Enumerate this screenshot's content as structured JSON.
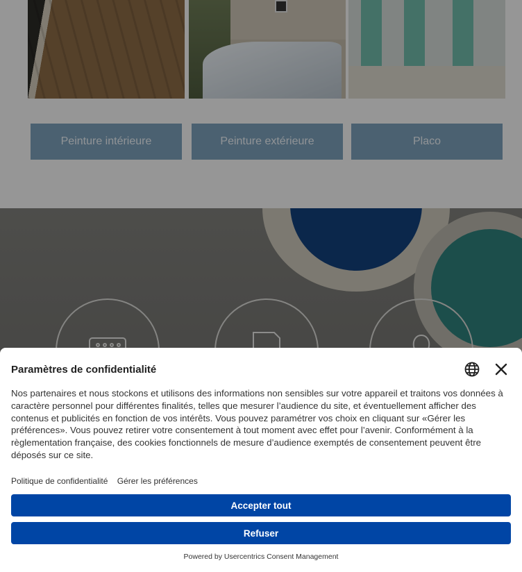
{
  "services": [
    {
      "label": "Peinture intérieure"
    },
    {
      "label": "Peinture extérieure"
    },
    {
      "label": "Placo"
    }
  ],
  "consent": {
    "title": "Paramètres de confidentialité",
    "body": "Nos partenaires et nous stockons et utilisons des informations non sensibles sur votre appareil et traitons vos données à caractère personnel pour différentes finalités, telles que mesurer l’audience du site, et éventuellement afficher des contenus et publicités en fonction de vos intérêts. Vous pouvez paramétrer vos choix en cliquant sur «Gérer les préférences». Vous pouvez retirer votre consentement à tout moment avec effet pour l’avenir. Conformément à la règlementation française, des cookies fonctionnels de mesure d’audience exemptés de consentement peuvent être déposés sur ce site.",
    "privacy_link": "Politique de confidentialité",
    "preferences_link": "Gérer les préférences",
    "accept_label": "Accepter tout",
    "refuse_label": "Refuser",
    "powered_by": "Powered by Usercentrics Consent Management"
  },
  "icons": {
    "language": "globe-icon",
    "close": "close-icon",
    "calendar": "calendar-icon",
    "document": "document-icon",
    "badge": "badge-icon"
  },
  "colors": {
    "primary_button": "#0045a5",
    "service_button": "#7a9db6"
  }
}
